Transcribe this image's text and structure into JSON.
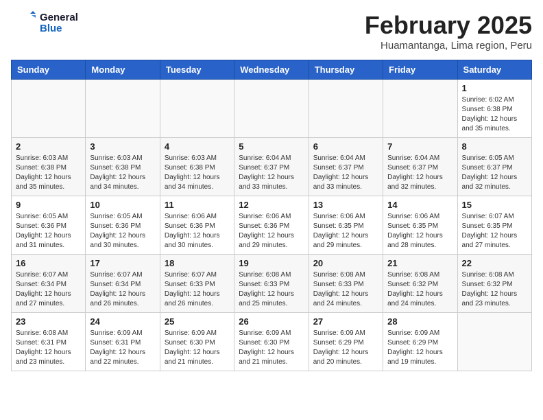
{
  "logo": {
    "text_general": "General",
    "text_blue": "Blue"
  },
  "title": {
    "month_year": "February 2025",
    "location": "Huamantanga, Lima region, Peru"
  },
  "days_of_week": [
    "Sunday",
    "Monday",
    "Tuesday",
    "Wednesday",
    "Thursday",
    "Friday",
    "Saturday"
  ],
  "weeks": [
    [
      {
        "day": "",
        "info": ""
      },
      {
        "day": "",
        "info": ""
      },
      {
        "day": "",
        "info": ""
      },
      {
        "day": "",
        "info": ""
      },
      {
        "day": "",
        "info": ""
      },
      {
        "day": "",
        "info": ""
      },
      {
        "day": "1",
        "info": "Sunrise: 6:02 AM\nSunset: 6:38 PM\nDaylight: 12 hours and 35 minutes."
      }
    ],
    [
      {
        "day": "2",
        "info": "Sunrise: 6:03 AM\nSunset: 6:38 PM\nDaylight: 12 hours and 35 minutes."
      },
      {
        "day": "3",
        "info": "Sunrise: 6:03 AM\nSunset: 6:38 PM\nDaylight: 12 hours and 34 minutes."
      },
      {
        "day": "4",
        "info": "Sunrise: 6:03 AM\nSunset: 6:38 PM\nDaylight: 12 hours and 34 minutes."
      },
      {
        "day": "5",
        "info": "Sunrise: 6:04 AM\nSunset: 6:37 PM\nDaylight: 12 hours and 33 minutes."
      },
      {
        "day": "6",
        "info": "Sunrise: 6:04 AM\nSunset: 6:37 PM\nDaylight: 12 hours and 33 minutes."
      },
      {
        "day": "7",
        "info": "Sunrise: 6:04 AM\nSunset: 6:37 PM\nDaylight: 12 hours and 32 minutes."
      },
      {
        "day": "8",
        "info": "Sunrise: 6:05 AM\nSunset: 6:37 PM\nDaylight: 12 hours and 32 minutes."
      }
    ],
    [
      {
        "day": "9",
        "info": "Sunrise: 6:05 AM\nSunset: 6:36 PM\nDaylight: 12 hours and 31 minutes."
      },
      {
        "day": "10",
        "info": "Sunrise: 6:05 AM\nSunset: 6:36 PM\nDaylight: 12 hours and 30 minutes."
      },
      {
        "day": "11",
        "info": "Sunrise: 6:06 AM\nSunset: 6:36 PM\nDaylight: 12 hours and 30 minutes."
      },
      {
        "day": "12",
        "info": "Sunrise: 6:06 AM\nSunset: 6:36 PM\nDaylight: 12 hours and 29 minutes."
      },
      {
        "day": "13",
        "info": "Sunrise: 6:06 AM\nSunset: 6:35 PM\nDaylight: 12 hours and 29 minutes."
      },
      {
        "day": "14",
        "info": "Sunrise: 6:06 AM\nSunset: 6:35 PM\nDaylight: 12 hours and 28 minutes."
      },
      {
        "day": "15",
        "info": "Sunrise: 6:07 AM\nSunset: 6:35 PM\nDaylight: 12 hours and 27 minutes."
      }
    ],
    [
      {
        "day": "16",
        "info": "Sunrise: 6:07 AM\nSunset: 6:34 PM\nDaylight: 12 hours and 27 minutes."
      },
      {
        "day": "17",
        "info": "Sunrise: 6:07 AM\nSunset: 6:34 PM\nDaylight: 12 hours and 26 minutes."
      },
      {
        "day": "18",
        "info": "Sunrise: 6:07 AM\nSunset: 6:33 PM\nDaylight: 12 hours and 26 minutes."
      },
      {
        "day": "19",
        "info": "Sunrise: 6:08 AM\nSunset: 6:33 PM\nDaylight: 12 hours and 25 minutes."
      },
      {
        "day": "20",
        "info": "Sunrise: 6:08 AM\nSunset: 6:33 PM\nDaylight: 12 hours and 24 minutes."
      },
      {
        "day": "21",
        "info": "Sunrise: 6:08 AM\nSunset: 6:32 PM\nDaylight: 12 hours and 24 minutes."
      },
      {
        "day": "22",
        "info": "Sunrise: 6:08 AM\nSunset: 6:32 PM\nDaylight: 12 hours and 23 minutes."
      }
    ],
    [
      {
        "day": "23",
        "info": "Sunrise: 6:08 AM\nSunset: 6:31 PM\nDaylight: 12 hours and 23 minutes."
      },
      {
        "day": "24",
        "info": "Sunrise: 6:09 AM\nSunset: 6:31 PM\nDaylight: 12 hours and 22 minutes."
      },
      {
        "day": "25",
        "info": "Sunrise: 6:09 AM\nSunset: 6:30 PM\nDaylight: 12 hours and 21 minutes."
      },
      {
        "day": "26",
        "info": "Sunrise: 6:09 AM\nSunset: 6:30 PM\nDaylight: 12 hours and 21 minutes."
      },
      {
        "day": "27",
        "info": "Sunrise: 6:09 AM\nSunset: 6:29 PM\nDaylight: 12 hours and 20 minutes."
      },
      {
        "day": "28",
        "info": "Sunrise: 6:09 AM\nSunset: 6:29 PM\nDaylight: 12 hours and 19 minutes."
      },
      {
        "day": "",
        "info": ""
      }
    ]
  ]
}
